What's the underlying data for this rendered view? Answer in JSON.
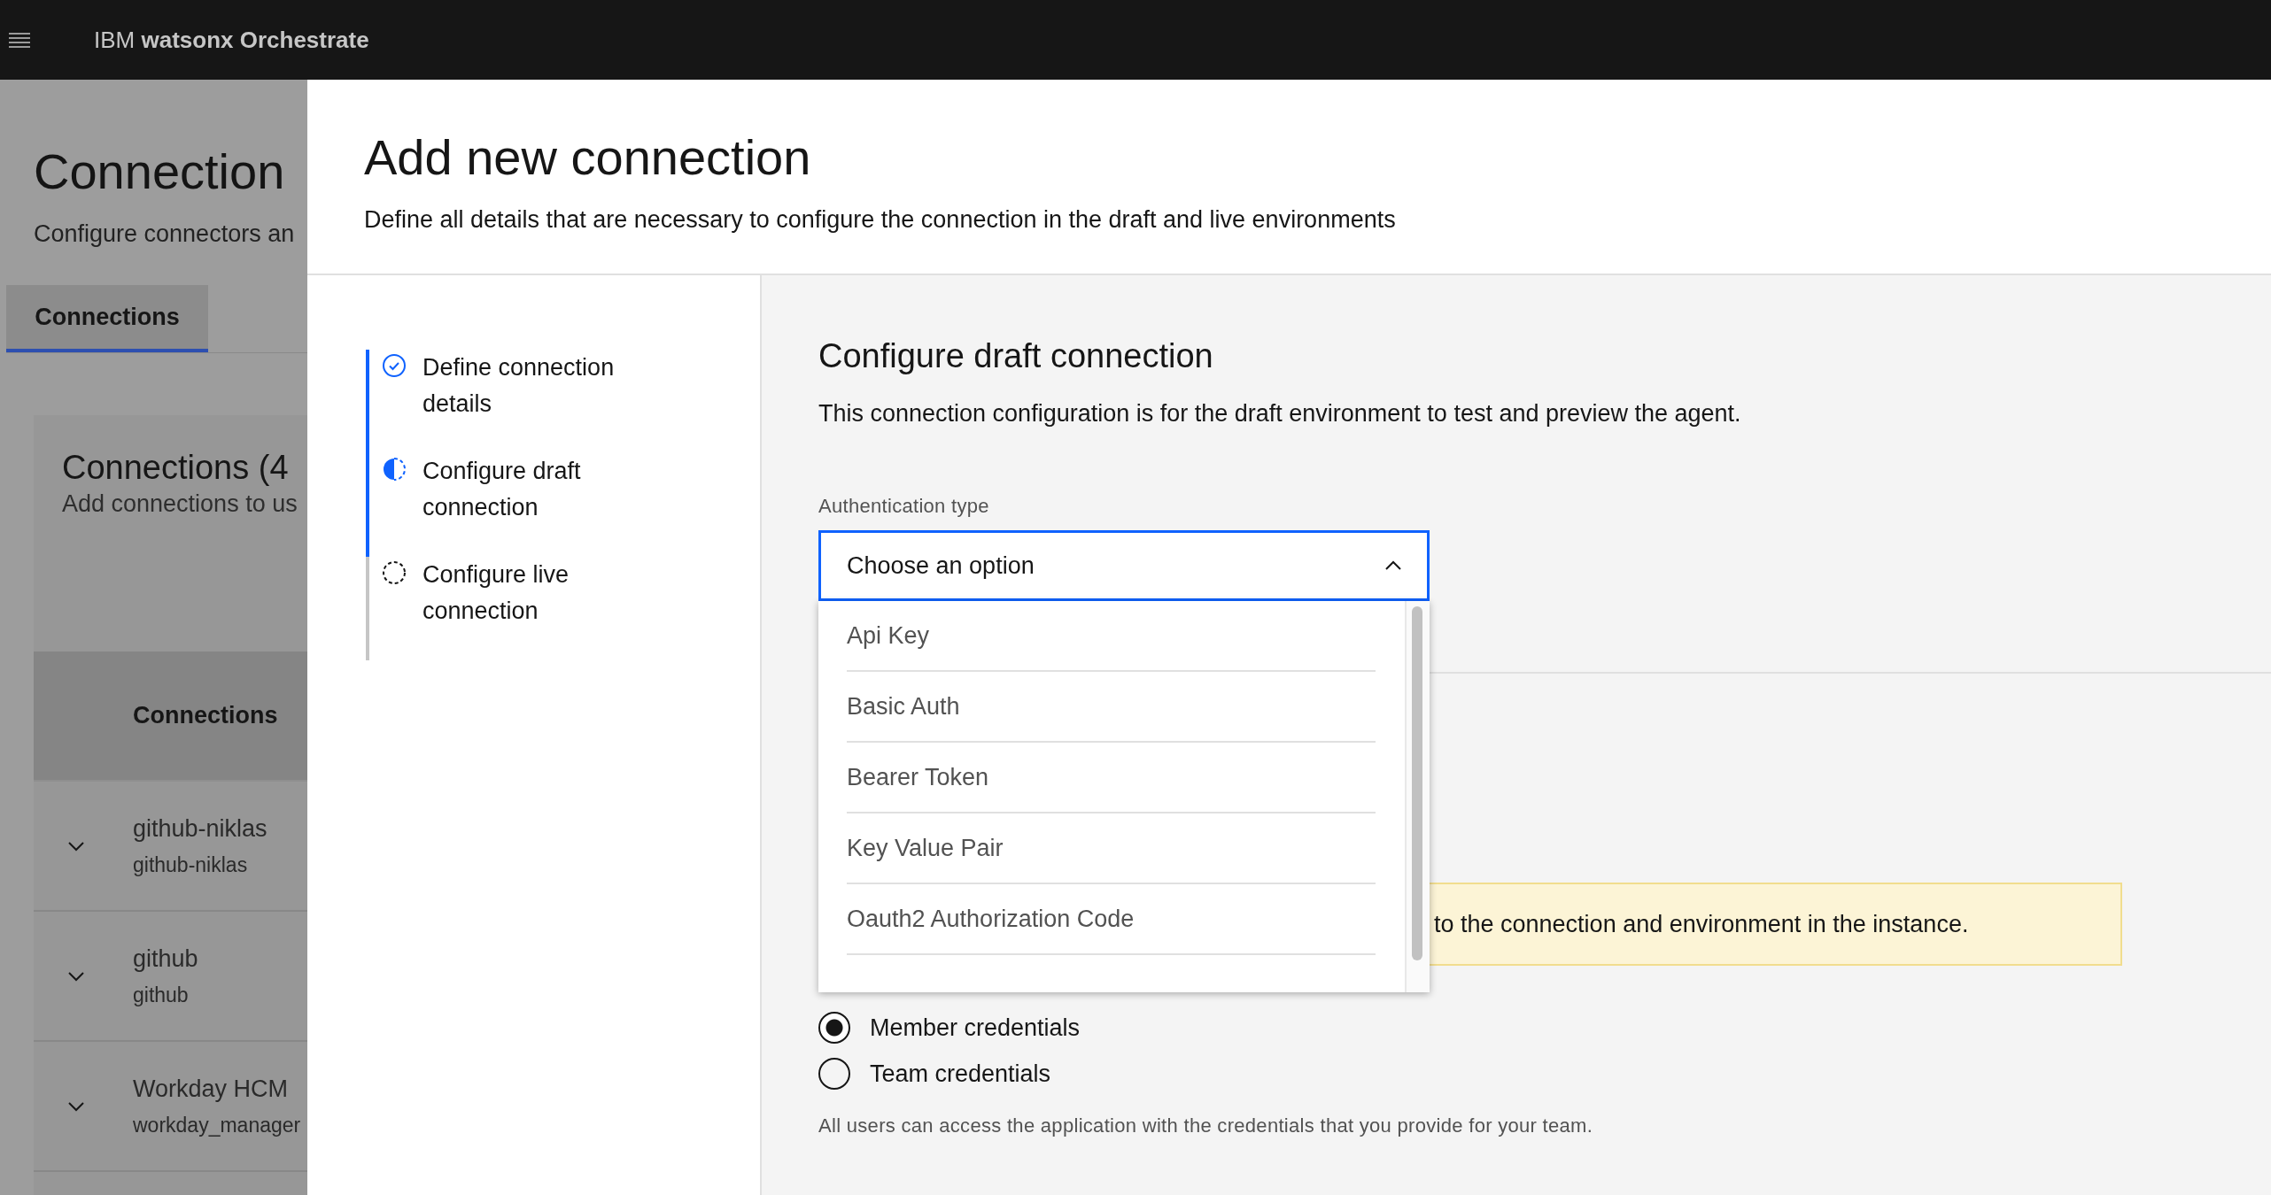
{
  "top_bar": {
    "brand_prefix": "IBM",
    "brand_name": "watsonx Orchestrate"
  },
  "background_page": {
    "title": "Connection",
    "subtitle": "Configure connectors an",
    "tabs": [
      {
        "label": "Connections",
        "selected": true
      }
    ],
    "card": {
      "title": "Connections (4",
      "subtitle": "Add connections to us"
    },
    "table": {
      "columns": [
        "Connections"
      ],
      "rows": [
        {
          "name": "github-niklas",
          "id": "github-niklas"
        },
        {
          "name": "github",
          "id": "github"
        },
        {
          "name": "Workday HCM",
          "id": "workday_manager"
        }
      ]
    }
  },
  "panel": {
    "title": "Add new connection",
    "description": "Define all details that are necessary to configure the connection in the draft and live environments"
  },
  "steps": [
    {
      "label": "Define connection details",
      "kind": "complete"
    },
    {
      "label": "Configure draft connection",
      "kind": "current"
    },
    {
      "label": "Configure live connection",
      "kind": "incomplete"
    }
  ],
  "form": {
    "title": "Configure draft connection",
    "description": "This connection configuration is for the draft environment to test and preview the agent.",
    "auth_field": {
      "label": "Authentication type",
      "prompt": "Choose an option",
      "expanded": true,
      "options": [
        "Api Key",
        "Basic Auth",
        "Bearer Token",
        "Key Value Pair",
        "Oauth2 Authorization Code"
      ]
    },
    "notice": {
      "text": "to the connection and environment in the instance."
    },
    "credentials": [
      {
        "label": "Member credentials",
        "selected": true
      },
      {
        "label": "Team credentials",
        "selected": false
      }
    ],
    "helper": "All users can access the application with the credentials that you provide for your team."
  }
}
